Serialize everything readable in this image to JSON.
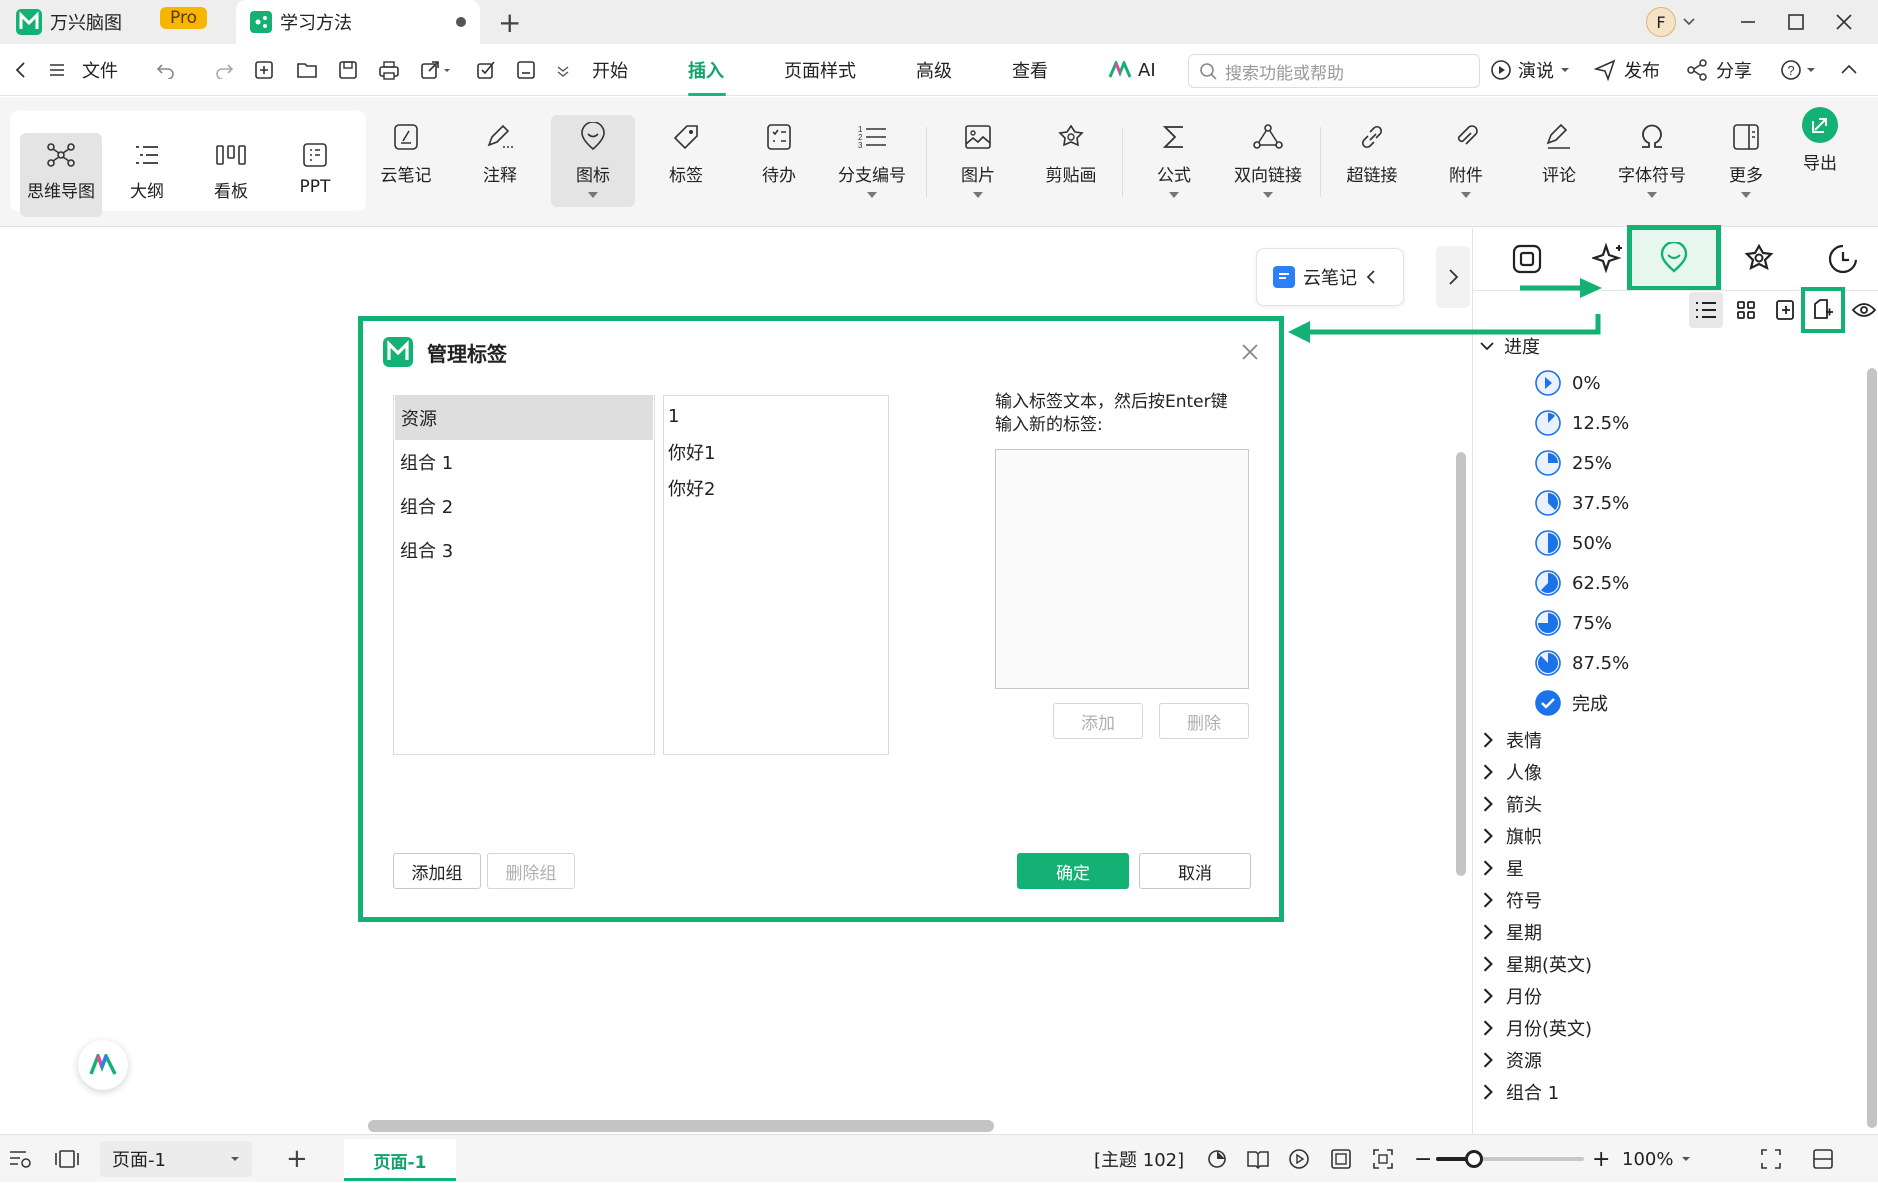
{
  "titlebar": {
    "app_name": "万兴脑图",
    "pro_badge": "Pro",
    "doc_tab": "学习方法",
    "new_tab": "+",
    "user_initial": "F"
  },
  "menubar": {
    "file": "文件",
    "items": [
      "开始",
      "插入",
      "页面样式",
      "高级",
      "查看",
      "AI"
    ],
    "active": "插入",
    "search_placeholder": "搜索功能或帮助",
    "present": "演说",
    "publish": "发布",
    "share": "分享"
  },
  "toolbar": {
    "views": [
      "思维导图",
      "大纲",
      "看板",
      "PPT"
    ],
    "tools": [
      "云笔记",
      "注释",
      "图标",
      "标签",
      "待办",
      "分支编号",
      "图片",
      "剪贴画",
      "公式",
      "双向链接",
      "超链接",
      "附件",
      "评论",
      "字体符号",
      "更多",
      "导出"
    ]
  },
  "canvas": {
    "cloud_note_button": "云笔记"
  },
  "right_panel": {
    "progress_group": "进度",
    "progress_items": [
      "0%",
      "12.5%",
      "25%",
      "37.5%",
      "50%",
      "62.5%",
      "75%",
      "87.5%",
      "完成"
    ],
    "progress_values": [
      0,
      0.125,
      0.25,
      0.375,
      0.5,
      0.625,
      0.75,
      0.875,
      1
    ],
    "groups": [
      "表情",
      "人像",
      "箭头",
      "旗帜",
      "星",
      "符号",
      "星期",
      "星期(英文)",
      "月份",
      "月份(英文)",
      "资源",
      "组合 1"
    ]
  },
  "modal": {
    "title": "管理标签",
    "groups": [
      "资源",
      "组合 1",
      "组合 2",
      "组合 3"
    ],
    "selected_group": "资源",
    "tags": [
      "1",
      "你好1",
      "你好2"
    ],
    "hint_line1": "输入标签文本，然后按Enter键",
    "hint_line2": "输入新的标签:",
    "add": "添加",
    "delete": "删除",
    "add_group": "添加组",
    "delete_group": "删除组",
    "ok": "确定",
    "cancel": "取消"
  },
  "bottombar": {
    "page_select": "页面-1",
    "page_tab": "页面-1",
    "topic_count": "[主题 102]",
    "zoom": "100%"
  },
  "colors": {
    "accent": "#14b174",
    "progress_blue": "#1a73e8"
  }
}
